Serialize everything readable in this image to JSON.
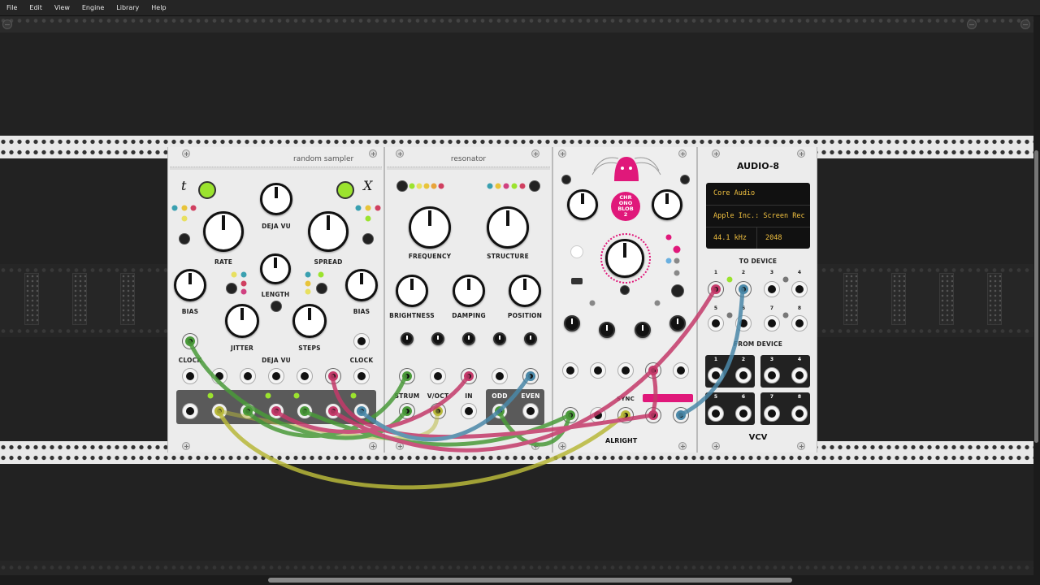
{
  "menu": [
    "File",
    "Edit",
    "View",
    "Engine",
    "Library",
    "Help"
  ],
  "modules": {
    "random_sampler": {
      "title": "random sampler",
      "t_label": "t",
      "x_label": "X",
      "labels": {
        "deja_vu": "DEJA VU",
        "rate": "RATE",
        "spread": "SPREAD",
        "length": "LENGTH",
        "bias": "BIAS",
        "jitter": "JITTER",
        "steps": "STEPS",
        "clock": "CLOCK"
      }
    },
    "resonator": {
      "title": "resonator",
      "labels": {
        "frequency": "FREQUENCY",
        "structure": "STRUCTURE",
        "brightness": "BRIGHTNESS",
        "damping": "DAMPING",
        "position": "POSITION",
        "strum": "STRUM",
        "voct": "V/OCT",
        "in": "IN",
        "odd": "ODD",
        "even": "EVEN"
      }
    },
    "chronoblob": {
      "logo_text": "CHR ONO BLOB 2",
      "brand": "ALRIGHT",
      "sync": "SYNC"
    },
    "audio8": {
      "title": "AUDIO-8",
      "driver": "Core Audio",
      "device": "Apple Inc.: Screen Rec",
      "sample_rate": "44.1 kHz",
      "block_size": "2048",
      "to_device": "TO DEVICE",
      "from_device": "FROM DEVICE",
      "brand": "VCV"
    }
  },
  "colors": {
    "lime": "#9be32e",
    "green_cable": "#4a9a3a",
    "pink_cable": "#c43a6a",
    "blue_cable": "#4a88a8",
    "yellow_cable": "#b8b83a",
    "chronoblob_pink": "#e0187a",
    "display_text": "#f0c040"
  }
}
